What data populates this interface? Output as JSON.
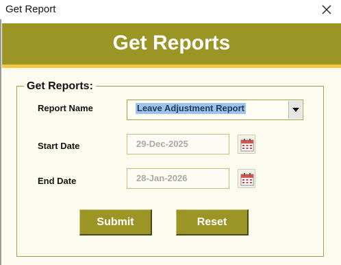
{
  "window": {
    "title": "Get Report"
  },
  "header": {
    "heading": "Get Reports"
  },
  "form": {
    "group_title": "Get Reports:",
    "report_name_label": "Report Name",
    "report_name_value": "Leave Adjustment Report",
    "start_date_label": "Start Date",
    "start_date_value": "29-Dec-2025",
    "end_date_label": "End Date",
    "end_date_value": "28-Jan-2026"
  },
  "buttons": {
    "submit": "Submit",
    "reset": "Reset"
  },
  "icons": {
    "close": "close-icon",
    "dropdown": "chevron-down-icon",
    "calendar": "calendar-icon"
  },
  "colors": {
    "banner": "#9b9526",
    "accent_stripe": "#f5c842",
    "background": "#fcfbf0",
    "selection": "#9dc3e6"
  }
}
